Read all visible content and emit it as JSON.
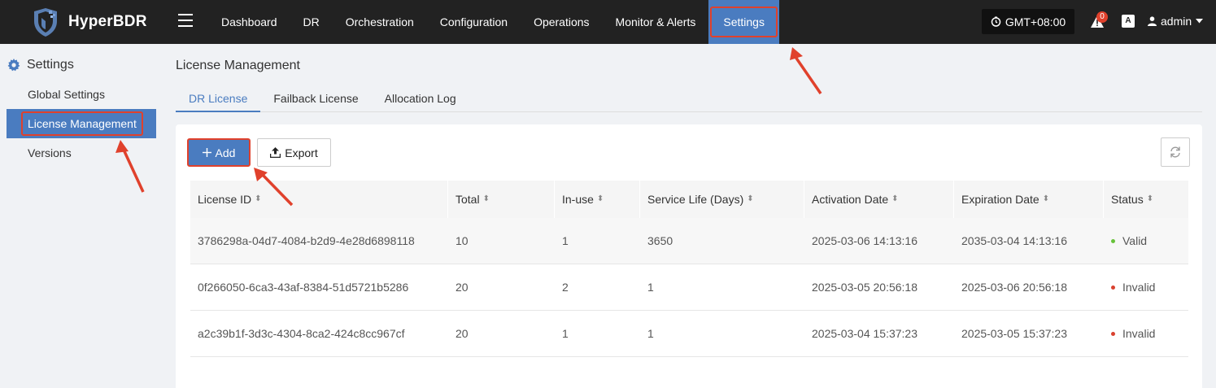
{
  "app": {
    "name": "HyperBDR"
  },
  "nav": {
    "items": [
      {
        "label": "Dashboard"
      },
      {
        "label": "DR"
      },
      {
        "label": "Orchestration"
      },
      {
        "label": "Configuration"
      },
      {
        "label": "Operations"
      },
      {
        "label": "Monitor & Alerts"
      },
      {
        "label": "Settings"
      }
    ],
    "active": "Settings"
  },
  "header": {
    "timezone": "GMT+08:00",
    "alert_count": "0",
    "lang_icon": "A",
    "user": "admin"
  },
  "sidebar": {
    "title": "Settings",
    "items": [
      {
        "label": "Global Settings"
      },
      {
        "label": "License Management"
      },
      {
        "label": "Versions"
      }
    ],
    "active": "License Management"
  },
  "main": {
    "title": "License Management",
    "tabs": [
      {
        "label": "DR License"
      },
      {
        "label": "Failback License"
      },
      {
        "label": "Allocation Log"
      }
    ],
    "active_tab": "DR License",
    "add_label": "Add",
    "export_label": "Export"
  },
  "table": {
    "columns": [
      "License ID",
      "Total",
      "In-use",
      "Service Life (Days)",
      "Activation Date",
      "Expiration Date",
      "Status"
    ],
    "rows": [
      {
        "id": "3786298a-04d7-4084-b2d9-4e28d6898118",
        "total": "10",
        "in_use": "1",
        "life": "3650",
        "activation": "2025-03-06 14:13:16",
        "expiration": "2035-03-04 14:13:16",
        "status": "Valid"
      },
      {
        "id": "0f266050-6ca3-43af-8384-51d5721b5286",
        "total": "20",
        "in_use": "2",
        "life": "1",
        "activation": "2025-03-05 20:56:18",
        "expiration": "2025-03-06 20:56:18",
        "status": "Invalid"
      },
      {
        "id": "a2c39b1f-3d3c-4304-8ca2-424c8cc967cf",
        "total": "20",
        "in_use": "1",
        "life": "1",
        "activation": "2025-03-04 15:37:23",
        "expiration": "2025-03-05 15:37:23",
        "status": "Invalid"
      }
    ]
  },
  "colors": {
    "topbar": "#222222",
    "accent": "#4a7cc0",
    "highlight": "#e0412c",
    "valid": "#67c23a",
    "invalid": "#d9412f"
  }
}
